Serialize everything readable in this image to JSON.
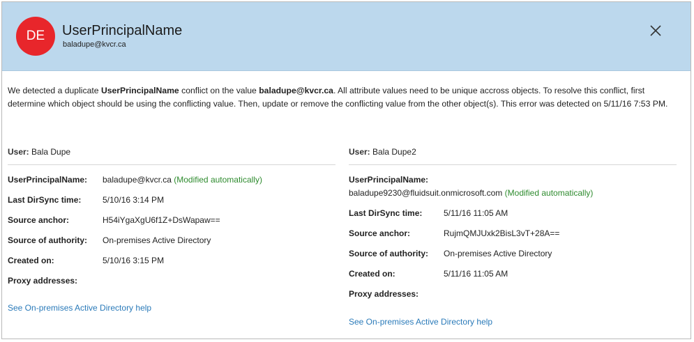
{
  "header": {
    "initials": "DE",
    "title": "UserPrincipalName",
    "subtitle": "baladupe@kvcr.ca",
    "avatar_color": "#e8262b",
    "background_color": "#bcd8ed",
    "close_icon": "close-icon"
  },
  "message": {
    "p1": "We detected a duplicate ",
    "attr": "UserPrincipalName",
    "p2": " conflict on the value ",
    "value": "baladupe@kvcr.ca",
    "p3": ". All attribute values need to be unique accross objects. To resolve this conflict, first determine which object should be using the conflicting value. Then, update or remove the conflicting value from the other object(s). This error was detected on 5/11/16 7:53 PM."
  },
  "left": {
    "user_label": "User:",
    "user_name": "Bala Dupe",
    "upn_label": "UserPrincipalName:",
    "upn_value": "baladupe@kvcr.ca",
    "upn_note": "(Modified automatically)",
    "dirsync_label": "Last DirSync time:",
    "dirsync_value": "5/10/16 3:14 PM",
    "anchor_label": "Source anchor:",
    "anchor_value": "H54iYgaXgU6f1Z+DsWapaw==",
    "authority_label": "Source of authority:",
    "authority_value": "On-premises Active Directory",
    "created_label": "Created on:",
    "created_value": "5/10/16 3:15 PM",
    "proxy_label": "Proxy addresses:",
    "help_link": "See On-premises Active Directory help"
  },
  "right": {
    "user_label": "User:",
    "user_name": "Bala Dupe2",
    "upn_label": "UserPrincipalName:",
    "upn_value": "baladupe9230@fluidsuit.onmicrosoft.com",
    "upn_note": "(Modified automatically)",
    "dirsync_label": "Last DirSync time:",
    "dirsync_value": "5/11/16 11:05 AM",
    "anchor_label": "Source anchor:",
    "anchor_value": "RujmQMJUxk2BisL3vT+28A==",
    "authority_label": "Source of authority:",
    "authority_value": "On-premises Active Directory",
    "created_label": "Created on:",
    "created_value": "5/11/16 11:05 AM",
    "proxy_label": "Proxy addresses:",
    "help_link": "See On-premises Active Directory help"
  },
  "colors": {
    "link": "#2a7ab9",
    "modified_note": "#2e8b2e"
  }
}
